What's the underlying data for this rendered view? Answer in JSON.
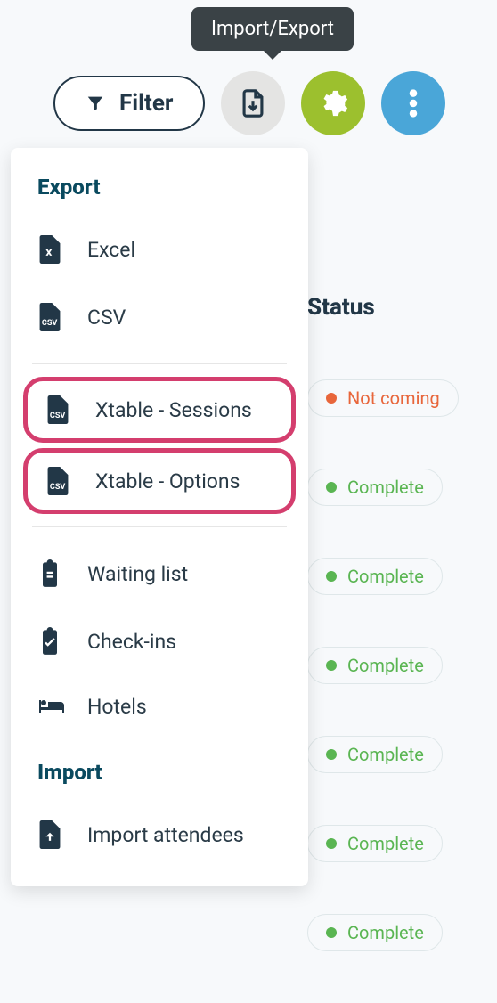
{
  "tooltip": "Import/Export",
  "toolbar": {
    "filter_label": "Filter"
  },
  "menu": {
    "export_title": "Export",
    "import_title": "Import",
    "excel": "Excel",
    "csv": "CSV",
    "xtable_sessions": "Xtable - Sessions",
    "xtable_options": "Xtable - Options",
    "waiting_list": "Waiting list",
    "check_ins": "Check-ins",
    "hotels": "Hotels",
    "import_attendees": "Import attendees"
  },
  "status": {
    "header": "Status",
    "not_coming": "Not coming",
    "complete": "Complete"
  }
}
